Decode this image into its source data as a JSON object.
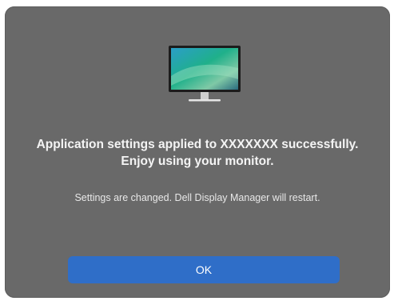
{
  "dialog": {
    "icon": "monitor-icon",
    "title": "Application settings applied to XXXXXXX successfully. Enjoy using your monitor.",
    "message": "Settings are changed. Dell Display Manager will restart.",
    "ok_label": "OK"
  },
  "colors": {
    "background": "#696969",
    "accent": "#2f6ec8"
  }
}
